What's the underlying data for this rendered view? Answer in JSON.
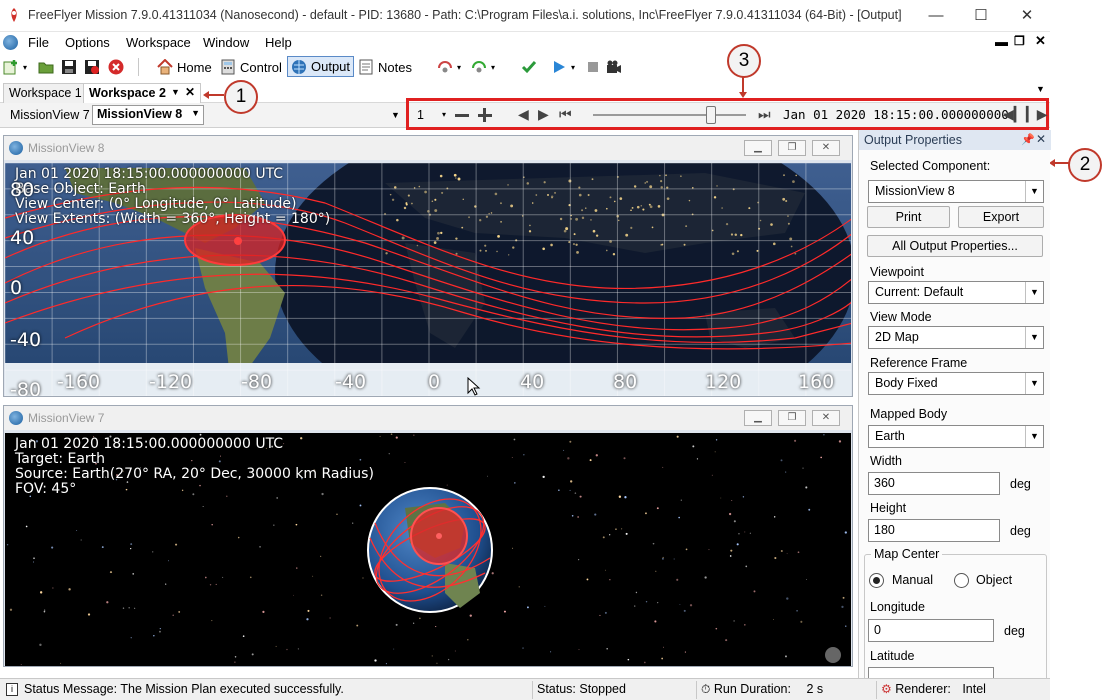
{
  "window": {
    "title": "FreeFlyer Mission 7.9.0.41311034 (Nanosecond) - default - PID: 13680 - Path: C:\\Program Files\\a.i. solutions, Inc\\FreeFlyer 7.9.0.41311034 (64-Bit) - [Output]",
    "minimize": "—",
    "maximize": "☐",
    "close": "✕"
  },
  "menu": {
    "items": [
      "File",
      "Options",
      "Workspace",
      "Window",
      "Help"
    ]
  },
  "toolbar": {
    "home_label": "Home",
    "control_label": "Control",
    "output_label": "Output",
    "notes_label": "Notes"
  },
  "workspaces": {
    "tabs": [
      "Workspace 1",
      "Workspace 2"
    ]
  },
  "viewrow": {
    "view_label": "MissionView 7",
    "view_selected": "MissionView 8",
    "step_value": "1",
    "epoch": "Jan 01 2020 18:15:00.000000000",
    "slider_value": 0.77
  },
  "callouts": {
    "c1": "1",
    "c2": "2",
    "c3": "3"
  },
  "mv8": {
    "title": "MissionView 8",
    "overlay": [
      "Jan 01 2020 18:15:00.000000000 UTC",
      "Base Object: Earth",
      "View Center: (0° Longitude, 0° Latitude)",
      "View Extents: (Width = 360°, Height = 180°)"
    ],
    "lat_ticks": [
      "80",
      "40",
      "0",
      "-40",
      "-80"
    ],
    "lon_ticks": [
      "-160",
      "-120",
      "-80",
      "-40",
      "0",
      "40",
      "80",
      "120",
      "160"
    ]
  },
  "mv7": {
    "title": "MissionView 7",
    "overlay": [
      "Jan 01 2020 18:15:00.000000000 UTC",
      "Target: Earth",
      "Source: Earth(270° RA, 20° Dec, 30000 km Radius)",
      "FOV: 45°"
    ]
  },
  "panel": {
    "header": "Output Properties",
    "selected_component_label": "Selected Component:",
    "selected_component": "MissionView 8",
    "print": "Print",
    "export": "Export",
    "all_props": "All Output Properties...",
    "viewpoint_label": "Viewpoint",
    "viewpoint": "Current: Default",
    "view_mode_label": "View Mode",
    "view_mode": "2D Map",
    "ref_frame_label": "Reference Frame",
    "ref_frame": "Body Fixed",
    "mapped_body_label": "Mapped Body",
    "mapped_body": "Earth",
    "width_label": "Width",
    "width": "360",
    "height_label": "Height",
    "height": "180",
    "unit": "deg",
    "map_center_label": "Map Center",
    "manual": "Manual",
    "object": "Object",
    "longitude_label": "Longitude",
    "longitude": "0",
    "latitude_label": "Latitude"
  },
  "status": {
    "message": "Status Message: The Mission Plan executed successfully.",
    "state": "Status: Stopped",
    "run_duration_label": "Run Duration:",
    "run_duration": "2 s",
    "renderer_label": "Renderer:",
    "renderer": "Intel"
  },
  "colors": {
    "accent_red": "#e02020",
    "panel_header": "#dfe7f2",
    "trail_red": "#ff3030"
  }
}
